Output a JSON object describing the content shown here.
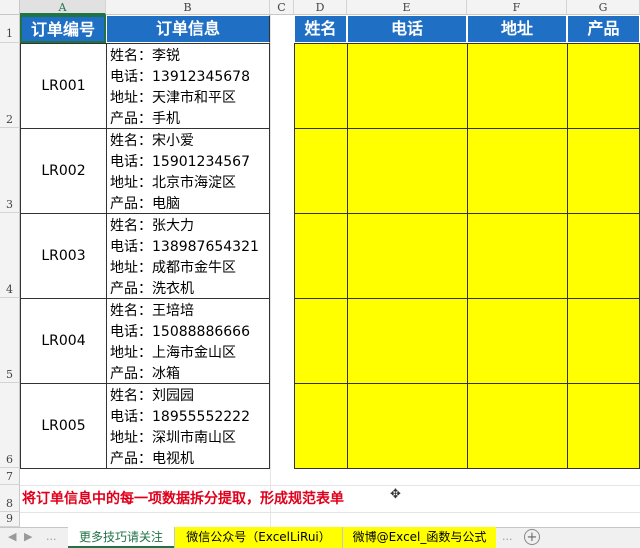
{
  "columns": [
    "A",
    "B",
    "C",
    "D",
    "E",
    "F",
    "G"
  ],
  "rows": [
    "1",
    "2",
    "3",
    "4",
    "5",
    "6",
    "7",
    "8",
    "9"
  ],
  "header": {
    "order_no": "订单编号",
    "order_info": "订单信息",
    "name": "姓名",
    "phone": "电话",
    "address": "地址",
    "product": "产品"
  },
  "orders": [
    {
      "id": "LR001",
      "name": "姓名：李锐",
      "phone": "电话：13912345678",
      "address": "地址：天津市和平区",
      "product": "产品：手机"
    },
    {
      "id": "LR002",
      "name": "姓名：宋小爱",
      "phone": "电话：15901234567",
      "address": "地址：北京市海淀区",
      "product": "产品：电脑"
    },
    {
      "id": "LR003",
      "name": "姓名：张大力",
      "phone": "电话：138987654321",
      "address": "地址：成都市金牛区",
      "product": "产品：洗衣机"
    },
    {
      "id": "LR004",
      "name": "姓名：王培培",
      "phone": "电话：15088886666",
      "address": "地址：上海市金山区",
      "product": "产品：冰箱"
    },
    {
      "id": "LR005",
      "name": "姓名：刘园园",
      "phone": "电话：18955552222",
      "address": "地址：深圳市南山区",
      "product": "产品：电视机"
    }
  ],
  "note": "将订单信息中的每一项数据拆分提取，形成规范表单",
  "tabs": [
    "更多技巧请关注",
    "微信公众号（ExcelLiRui）",
    "微博@Excel_函数与公式"
  ],
  "nav": {
    "prev": "◀",
    "next": "▶",
    "more": "..."
  },
  "add_sheet": "+",
  "cursor_glyph": "✥",
  "colors": {
    "header_blue": "#1f6fc5",
    "fill_yellow": "#ffff00",
    "note_red": "#e0001b",
    "excel_green": "#217346"
  }
}
